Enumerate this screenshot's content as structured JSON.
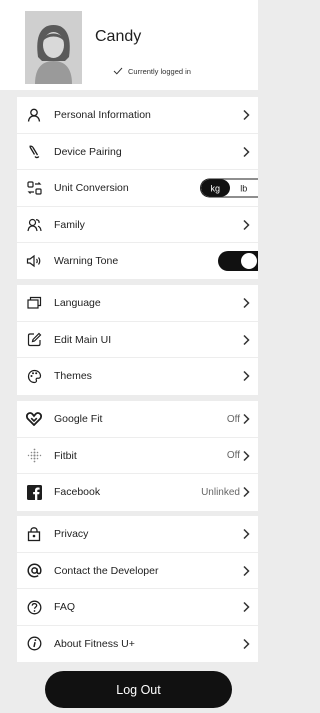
{
  "profile": {
    "name": "Candy",
    "status": "Currently logged in"
  },
  "menu": {
    "personal_information": "Personal Information",
    "device_pairing": "Device Pairing",
    "unit_conversion": "Unit Conversion",
    "unit_options": [
      "kg",
      "lb"
    ],
    "unit_selected": "kg",
    "family": "Family",
    "warning_tone": "Warning Tone",
    "warning_tone_on": true,
    "language": "Language",
    "edit_main_ui": "Edit Main UI",
    "themes": "Themes",
    "google_fit": "Google Fit",
    "google_fit_status": "Off",
    "fitbit": "Fitbit",
    "fitbit_status": "Off",
    "facebook": "Facebook",
    "facebook_status": "Unlinked",
    "privacy": "Privacy",
    "contact_developer": "Contact the Developer",
    "faq": "FAQ",
    "about": "About Fitness U+"
  },
  "logout_label": "Log Out",
  "colors": {
    "background": "#ececec",
    "surface": "#ffffff",
    "primary": "#111111"
  }
}
